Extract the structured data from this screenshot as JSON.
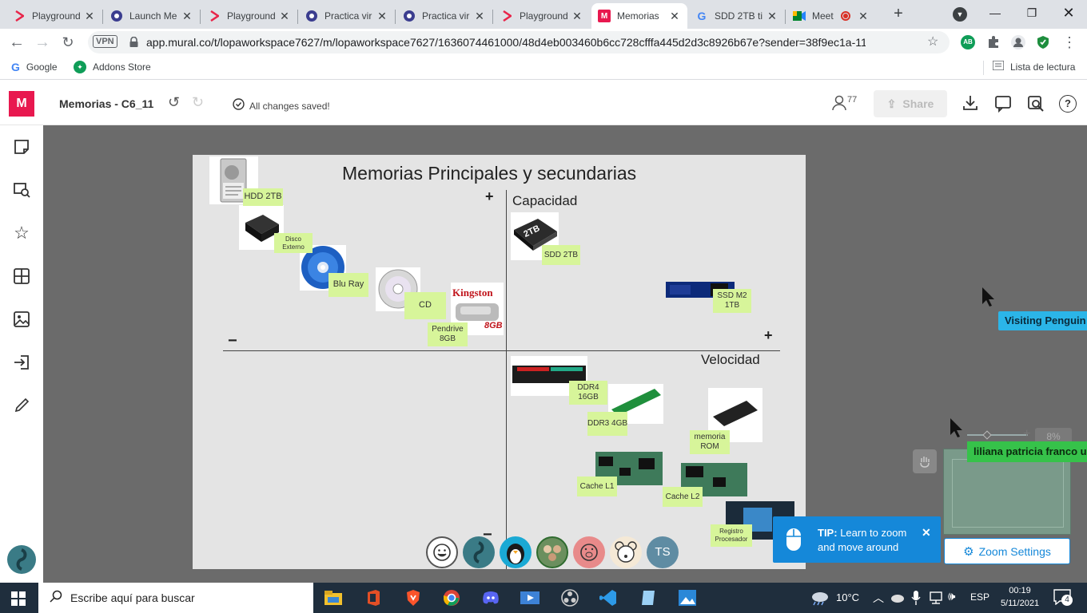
{
  "browser": {
    "tabs": [
      {
        "title": "Playground",
        "icon": "playground-icon",
        "color": "#e8254a"
      },
      {
        "title": "Launch Me",
        "icon": "globe-icon",
        "color": "#3b3d8f"
      },
      {
        "title": "Playground",
        "icon": "playground-icon",
        "color": "#e8254a"
      },
      {
        "title": "Practica vir",
        "icon": "globe-icon",
        "color": "#3b3d8f"
      },
      {
        "title": "Practica vir",
        "icon": "globe-icon",
        "color": "#3b3d8f"
      },
      {
        "title": "Playground",
        "icon": "playground-icon",
        "color": "#e8254a"
      },
      {
        "title": "Memorias",
        "icon": "mural-icon",
        "color": "#e8184f"
      },
      {
        "title": "SDD 2TB ti",
        "icon": "google-icon",
        "color": "#4285f4"
      },
      {
        "title": "Meet",
        "icon": "meet-icon",
        "color": "#00832d"
      }
    ],
    "url": "app.mural.co/t/lopaworkspace7627/m/lopaworkspace7627/1636074461000/48d4eb003460b6cc728cfffa445d2d3c8926b67e?sender=38f9ec1a-1176-4b07-...",
    "vpn_label": "VPN",
    "bookmarks": [
      {
        "label": "Google",
        "icon": "google-icon"
      },
      {
        "label": "Addons Store",
        "icon": "addons-store-icon"
      }
    ],
    "reading_list": "Lista de lectura"
  },
  "mural": {
    "logo": "M",
    "title": "Memorias - C6_11",
    "save_status": "All changes saved!",
    "participants_count": "77",
    "share_label": "Share",
    "board_title": "Memorias Principales y secundarias",
    "axis": {
      "y_label": "Capacidad",
      "x_label": "Velocidad",
      "plus": "+",
      "minus": "−"
    },
    "notes": [
      {
        "id": "hdd",
        "text": "HDD 2TB"
      },
      {
        "id": "disco",
        "text": "Disco Externo"
      },
      {
        "id": "bluray",
        "text": "Blu Ray"
      },
      {
        "id": "cd",
        "text": "CD"
      },
      {
        "id": "pendrive",
        "text": "Pendrive 8GB"
      },
      {
        "id": "sdd",
        "text": "SDD 2TB"
      },
      {
        "id": "ssdm2",
        "text": "SSD M2 1TB"
      },
      {
        "id": "ddr4",
        "text": "DDR4 16GB"
      },
      {
        "id": "ddr3",
        "text": "DDR3 4GB"
      },
      {
        "id": "rom",
        "text": "memoria ROM"
      },
      {
        "id": "l1",
        "text": "Cache L1"
      },
      {
        "id": "l2",
        "text": "Cache L2"
      },
      {
        "id": "reg",
        "text": "Registro Procesador"
      }
    ],
    "image_text": {
      "kingston": "Kingston",
      "kingston_size": "8GB",
      "ssd_label": "2TB"
    },
    "cursors": [
      {
        "name": "Visiting Penguin",
        "color": "#2bb5e8"
      },
      {
        "name": "liliana patricia franco u",
        "color": "#36c24a"
      }
    ],
    "avatars": [
      "TS"
    ],
    "zoom_percent": "8%",
    "tip_bold": "TIP:",
    "tip_text": "Learn to zoom and move around",
    "zoom_settings": "Zoom Settings"
  },
  "taskbar": {
    "search_placeholder": "Escribe aquí para buscar",
    "weather": "10°C",
    "language": "ESP",
    "time": "00:19",
    "date": "5/11/2021",
    "notifications": "4"
  }
}
